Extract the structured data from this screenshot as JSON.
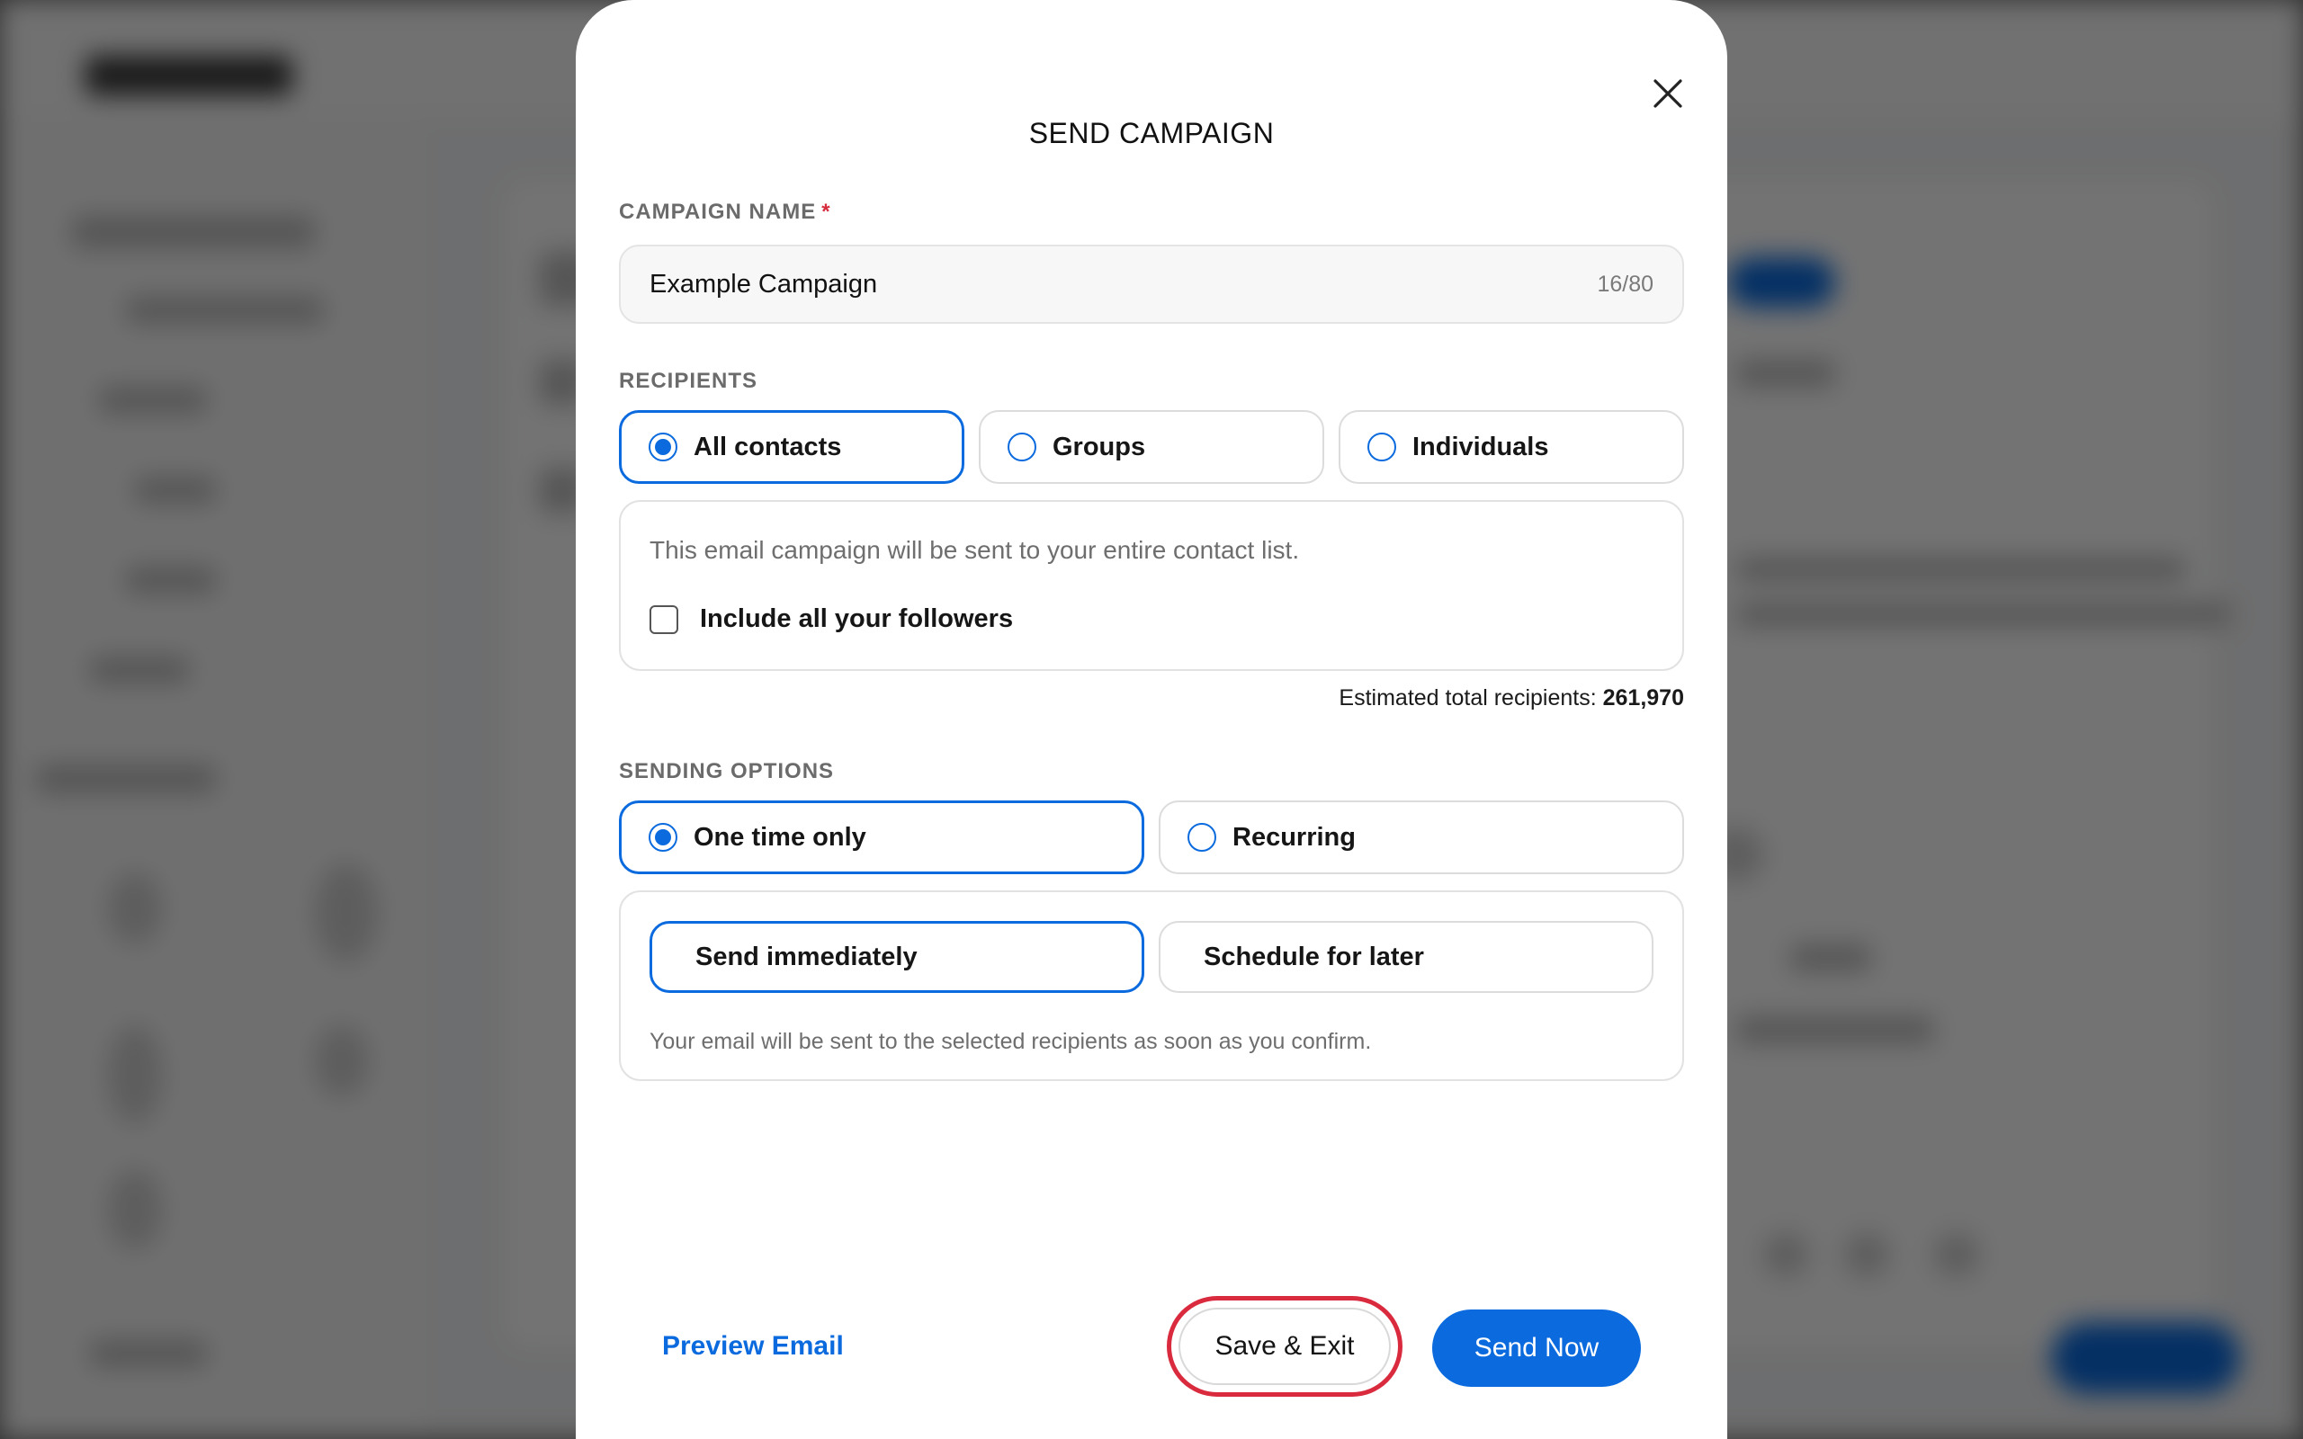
{
  "modal": {
    "title": "SEND CAMPAIGN",
    "close_icon": "close-icon"
  },
  "campaign_name": {
    "label": "CAMPAIGN NAME",
    "required_mark": "*",
    "value": "Example Campaign",
    "char_count": "16/80"
  },
  "recipients": {
    "label": "RECIPIENTS",
    "options": [
      {
        "label": "All contacts",
        "selected": true
      },
      {
        "label": "Groups",
        "selected": false
      },
      {
        "label": "Individuals",
        "selected": false
      }
    ],
    "description": "This email campaign will be sent to your entire contact list.",
    "include_followers_label": "Include all your followers",
    "include_followers_checked": false,
    "estimate_label": "Estimated total recipients:",
    "estimate_value": "261,970"
  },
  "sending_options": {
    "label": "SENDING OPTIONS",
    "frequency": [
      {
        "label": "One time only",
        "selected": true
      },
      {
        "label": "Recurring",
        "selected": false
      }
    ],
    "timing": [
      {
        "label": "Send immediately",
        "selected": true
      },
      {
        "label": "Schedule for later",
        "selected": false
      }
    ],
    "hint": "Your email will be sent to the selected recipients as soon as you confirm."
  },
  "footer": {
    "preview_label": "Preview Email",
    "save_exit_label": "Save & Exit",
    "send_now_label": "Send Now"
  },
  "colors": {
    "accent": "#0b6bde",
    "required": "#d62b3c",
    "focus_ring": "#d92a3e"
  }
}
